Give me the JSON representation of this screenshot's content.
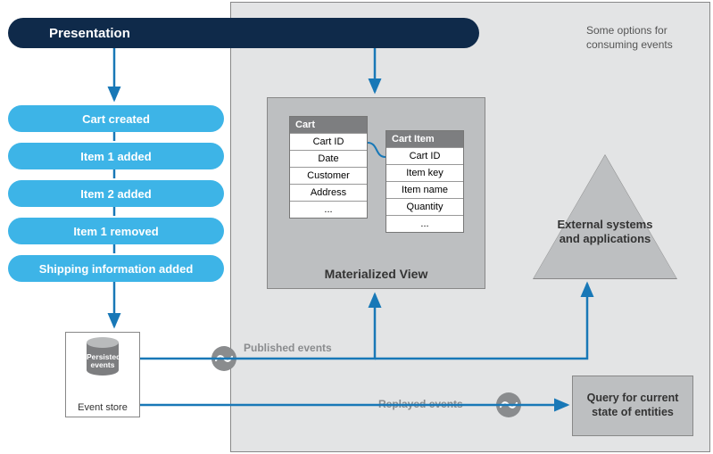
{
  "header": {
    "title": "Presentation"
  },
  "events": [
    "Cart created",
    "Item 1 added",
    "Item 2 added",
    "Item 1 removed",
    "Shipping information added"
  ],
  "event_store": {
    "cylinder_label": "Persisted\nevents",
    "caption": "Event store"
  },
  "materialized_view": {
    "title": "Materialized View",
    "tables": {
      "cart": {
        "name": "Cart",
        "fields": [
          "Cart ID",
          "Date",
          "Customer",
          "Address",
          "..."
        ]
      },
      "cart_item": {
        "name": "Cart Item",
        "fields": [
          "Cart ID",
          "Item key",
          "Item name",
          "Quantity",
          "..."
        ]
      }
    }
  },
  "external": {
    "label": "External systems and applications"
  },
  "query_box": {
    "label": "Query for current state of entities"
  },
  "flow_labels": {
    "published": "Published events",
    "replayed": "Replayed events"
  },
  "zone_note": "Some options for consuming events"
}
